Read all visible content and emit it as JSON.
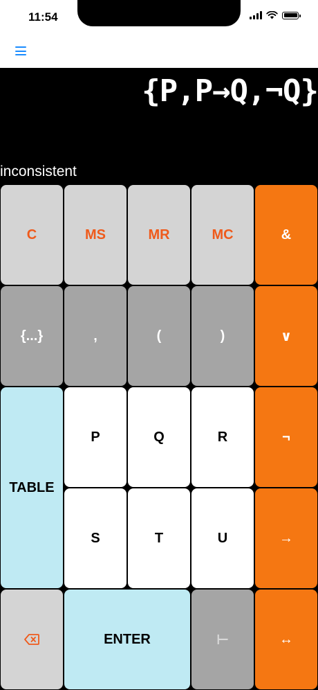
{
  "status_bar": {
    "time": "11:54"
  },
  "nav": {
    "menu_icon": "hamburger-icon"
  },
  "display": {
    "expression": "{P,P→Q,¬Q}",
    "result": "inconsistent"
  },
  "keys": {
    "clear": "C",
    "memory_store": "MS",
    "memory_recall": "MR",
    "memory_clear": "MC",
    "and": "&",
    "set": "{...}",
    "comma": ",",
    "open_paren": "(",
    "close_paren": ")",
    "or": "∨",
    "table": "TABLE",
    "p": "P",
    "q": "Q",
    "r": "R",
    "not": "¬",
    "s": "S",
    "t": "T",
    "u": "U",
    "implies": "→",
    "backspace_icon": "backspace-icon",
    "enter": "ENTER",
    "turnstile": "⊢",
    "iff": "↔"
  },
  "colors": {
    "operator": "#f57712",
    "memory_text": "#ef5a1b",
    "function_blue": "#bfeaf3",
    "nav_accent": "#1a8cff"
  }
}
